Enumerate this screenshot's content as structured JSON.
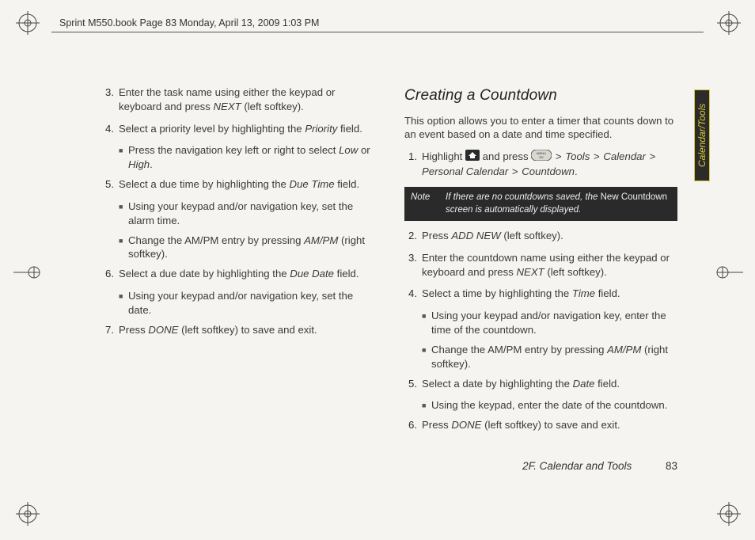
{
  "header": "Sprint M550.book  Page 83  Monday, April 13, 2009  1:03 PM",
  "sideTab": "Calendar/Tools",
  "footer": {
    "section": "2F. Calendar and Tools",
    "page": "83"
  },
  "left": {
    "s3": {
      "n": "3.",
      "t1": "Enter the task name using either the keypad or keyboard and press ",
      "k1": "NEXT",
      "t2": " (left softkey)."
    },
    "s4": {
      "n": "4.",
      "t1": "Select a priority level by highlighting the ",
      "k1": "Priority",
      "t2": " field.",
      "sub1_a": "Press the navigation key left or right to select ",
      "sub1_k1": "Low",
      "sub1_b": " or ",
      "sub1_k2": "High",
      "sub1_c": "."
    },
    "s5": {
      "n": "5.",
      "t1": "Select a due time by highlighting the ",
      "k1": "Due Time",
      "t2": " field.",
      "sub1": "Using your keypad and/or navigation key, set the alarm time.",
      "sub2_a": "Change the AM/PM entry by pressing ",
      "sub2_k1": "AM/PM",
      "sub2_b": " (right softkey)."
    },
    "s6": {
      "n": "6.",
      "t1": "Select a due date by highlighting the ",
      "k1": "Due Date",
      "t2": " field.",
      "sub1": "Using your keypad and/or navigation key, set the date."
    },
    "s7": {
      "n": "7.",
      "t1": "Press ",
      "k1": "DONE",
      "t2": " (left softkey) to save and exit."
    }
  },
  "right": {
    "h2": "Creating a Countdown",
    "intro": "This option allows you to enter a timer that counts down to an event based on a date and time specified.",
    "s1": {
      "n": "1.",
      "t1": "Highlight ",
      "t2": " and press ",
      "t3": " > ",
      "k1": "Tools",
      "k2": "Calendar",
      "k3": "Personal Calendar",
      "k4": "Countdown",
      "dot": "."
    },
    "note": {
      "label": "Note",
      "t1": "If there are no countdowns saved, the ",
      "u1": "New Countdown",
      "t2": " screen is automatically displayed."
    },
    "s2": {
      "n": "2.",
      "t1": "Press ",
      "k1": "ADD NEW",
      "t2": " (left softkey)."
    },
    "s3": {
      "n": "3.",
      "t1": "Enter the countdown name using either the keypad or keyboard and press ",
      "k1": "NEXT",
      "t2": " (left softkey)."
    },
    "s4": {
      "n": "4.",
      "t1": "Select a time by highlighting the ",
      "k1": "Time",
      "t2": " field.",
      "sub1": "Using your keypad and/or navigation key, enter the time of the countdown.",
      "sub2_a": "Change the AM/PM entry by pressing ",
      "sub2_k1": "AM/PM",
      "sub2_b": " (right softkey)."
    },
    "s5": {
      "n": "5.",
      "t1": "Select a date by highlighting the ",
      "k1": "Date",
      "t2": " field.",
      "sub1": "Using the keypad, enter the date of the countdown."
    },
    "s6": {
      "n": "6.",
      "t1": "Press ",
      "k1": "DONE",
      "t2": " (left softkey) to save and exit."
    }
  }
}
